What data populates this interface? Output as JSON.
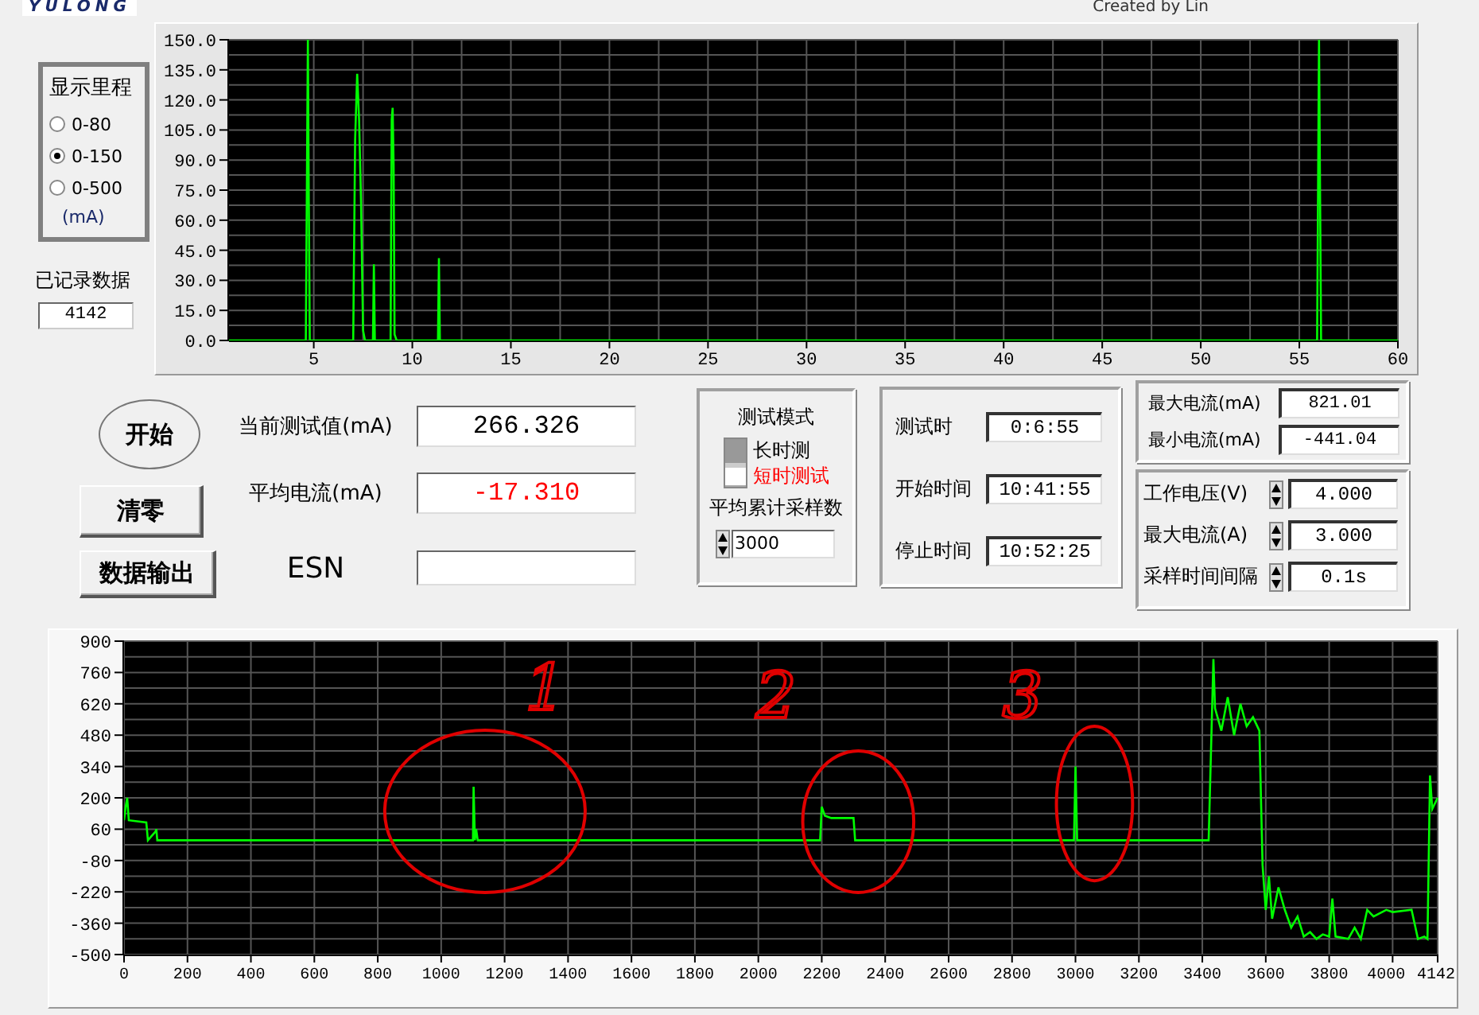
{
  "header": {
    "logo": "YULONG",
    "credit": "Created by Lin"
  },
  "range_group": {
    "title": "显示里程",
    "options": [
      {
        "label": "0-80",
        "selected": false
      },
      {
        "label": "0-150",
        "selected": true
      },
      {
        "label": "0-500",
        "selected": false
      }
    ],
    "unit": "(mA)"
  },
  "record_count": {
    "label": "已记录数据",
    "value": "4142"
  },
  "top_chart": {
    "chart_data": {
      "type": "line",
      "xlim": [
        0.7,
        60
      ],
      "ylim": [
        0,
        150
      ],
      "xticks": [
        5,
        10,
        15,
        20,
        25,
        30,
        35,
        40,
        45,
        50,
        55,
        60
      ],
      "yticks": [
        {
          "value": 0,
          "label": "0.0"
        },
        {
          "value": 15,
          "label": "15.0"
        },
        {
          "value": 30,
          "label": "30.0"
        },
        {
          "value": 45,
          "label": "45.0"
        },
        {
          "value": 60,
          "label": "60.0"
        },
        {
          "value": 75,
          "label": "75.0"
        },
        {
          "value": 90,
          "label": "90.0"
        },
        {
          "value": 105,
          "label": "105.0"
        },
        {
          "value": 120,
          "label": "120.0"
        },
        {
          "value": 135,
          "label": "135.0"
        },
        {
          "value": 150,
          "label": "150.0"
        }
      ],
      "x": [
        0.7,
        4.6,
        4.7,
        4.75,
        4.8,
        7.0,
        7.1,
        7.2,
        7.3,
        7.4,
        7.5,
        7.6,
        8.0,
        8.05,
        8.1,
        8.9,
        8.95,
        9.0,
        9.05,
        9.1,
        9.2,
        11.3,
        11.35,
        11.4,
        55.9,
        56,
        56.1,
        60
      ],
      "grid": true,
      "series": [
        {
          "color": "#00ff00",
          "values": [
            0,
            0,
            150,
            67,
            0,
            0,
            100,
            133,
            110,
            70,
            5,
            0,
            0,
            38,
            0,
            0,
            110,
            116,
            88,
            3,
            0,
            0,
            41,
            0,
            0,
            150,
            0,
            0
          ]
        }
      ]
    }
  },
  "buttons": [
    {
      "label": "开始",
      "kind": "oval"
    },
    {
      "label": "清零",
      "kind": "plain"
    },
    {
      "label": "数据输出",
      "kind": "plain"
    }
  ],
  "readings": [
    {
      "label": "当前测试值(mA)",
      "value": "266.326",
      "color": "#000000"
    },
    {
      "label": "平均电流(mA)",
      "value": "-17.310",
      "color": "#ff0000"
    },
    {
      "label": "ESN"
    }
  ],
  "mode_group": {
    "title": "测试模式",
    "options": [
      {
        "label": "长时测",
        "selected": false
      },
      {
        "label": "短时测试",
        "selected": true
      }
    ],
    "samples_label": "平均累计采样数",
    "samples": "3000"
  },
  "times": [
    {
      "label": "测试时",
      "value": "0:6:55"
    },
    {
      "label": "开始时间",
      "value": "10:41:55"
    },
    {
      "label": "停止时间",
      "value": "10:52:25"
    }
  ],
  "extremes": [
    {
      "label": "最大电流(mA)",
      "value": "821.01"
    },
    {
      "label": "最小电流(mA)",
      "value": "-441.04"
    }
  ],
  "settings": [
    {
      "label": "工作电压(V)",
      "value": "4.000"
    },
    {
      "label": "最大电流(A)",
      "value": "3.000"
    },
    {
      "label": "采样时间间隔",
      "value": "0.1s"
    }
  ],
  "bottom_chart": {
    "chart_data": {
      "type": "line",
      "xlim": [
        0,
        4142
      ],
      "ylim": [
        -500,
        900
      ],
      "xticks": [
        0,
        200,
        400,
        600,
        800,
        1000,
        1200,
        1400,
        1600,
        1800,
        2000,
        2200,
        2400,
        2600,
        2800,
        3000,
        3200,
        3400,
        3600,
        3800,
        4000,
        4142
      ],
      "yticks": [
        -500,
        -360,
        -220,
        -80,
        60,
        200,
        340,
        480,
        620,
        760,
        900
      ],
      "x": [
        0,
        5,
        10,
        15,
        70,
        75,
        100,
        102,
        105,
        1100,
        1102,
        1106,
        1110,
        1115,
        2195,
        2200,
        2210,
        2230,
        2300,
        2305,
        2995,
        3000,
        3005,
        3420,
        3430,
        3435,
        3440,
        3460,
        3480,
        3500,
        3520,
        3540,
        3560,
        3580,
        3590,
        3600,
        3610,
        3620,
        3640,
        3660,
        3680,
        3700,
        3720,
        3740,
        3760,
        3780,
        3800,
        3810,
        3820,
        3860,
        3880,
        3900,
        3920,
        3940,
        3980,
        4000,
        4060,
        4080,
        4100,
        4110,
        4118,
        4125,
        4142
      ],
      "grid": true,
      "series": [
        {
          "color": "#00ff00",
          "values": [
            100,
            160,
            200,
            100,
            90,
            10,
            50,
            60,
            10,
            10,
            250,
            10,
            60,
            10,
            10,
            160,
            120,
            110,
            110,
            10,
            10,
            340,
            10,
            10,
            550,
            820,
            600,
            500,
            650,
            480,
            620,
            520,
            560,
            500,
            -100,
            -300,
            -150,
            -340,
            -200,
            -300,
            -380,
            -330,
            -420,
            -400,
            -430,
            -410,
            -420,
            -250,
            -420,
            -430,
            -380,
            -430,
            -300,
            -330,
            -300,
            -310,
            -300,
            -430,
            -420,
            -430,
            300,
            150,
            200
          ]
        }
      ]
    },
    "handwritten_marks": [
      {
        "text": "1"
      },
      {
        "text": "2"
      },
      {
        "text": "3"
      }
    ]
  }
}
